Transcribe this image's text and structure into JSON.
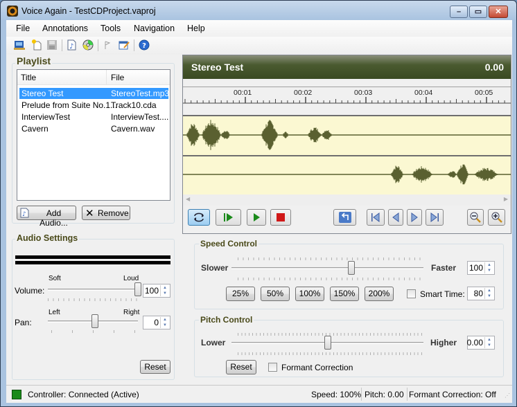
{
  "window": {
    "title": "Voice Again - TestCDProject.vaproj",
    "controls": {
      "minimize": "–",
      "maximize": "▭",
      "close": "✕"
    }
  },
  "menu": [
    "File",
    "Annotations",
    "Tools",
    "Navigation",
    "Help"
  ],
  "toolbar": {
    "icons": [
      "new-project-icon",
      "new-file-icon",
      "save-icon",
      "add-audio-icon",
      "cd-icon",
      "annotation-flag-icon",
      "edit-annotation-icon",
      "help-icon"
    ]
  },
  "playlist": {
    "title": "Playlist",
    "columns": [
      "Title",
      "File"
    ],
    "rows": [
      {
        "title": "Stereo Test",
        "file": "StereoTest.mp3",
        "selected": true
      },
      {
        "title": "Prelude from Suite No.1...",
        "file": "Track10.cda",
        "selected": false
      },
      {
        "title": "InterviewTest",
        "file": "InterviewTest....",
        "selected": false
      },
      {
        "title": "Cavern",
        "file": "Cavern.wav",
        "selected": false
      }
    ],
    "add_button": "Add Audio...",
    "remove_button": "Remove"
  },
  "audio_settings": {
    "title": "Audio Settings",
    "volume": {
      "label": "Volume:",
      "min_label": "Soft",
      "max_label": "Loud",
      "value": "100",
      "fraction": 1.0
    },
    "pan": {
      "label": "Pan:",
      "min_label": "Left",
      "max_label": "Right",
      "value": "0",
      "fraction": 0.5
    },
    "reset_button": "Reset"
  },
  "player": {
    "track_title": "Stereo Test",
    "time": "0.00",
    "ruler_labels": [
      "00:01",
      "00:02",
      "00:03",
      "00:04",
      "00:05"
    ],
    "wave_color": "#5a6030",
    "wave_bg": "#fbf8d2",
    "transport": [
      "loop-button",
      "play-from-start-button",
      "play-button",
      "stop-button",
      "return-button",
      "first-button",
      "previous-button",
      "next-button",
      "last-button",
      "zoom-out-button",
      "zoom-in-button"
    ]
  },
  "speed_control": {
    "title": "Speed Control",
    "min_label": "Slower",
    "max_label": "Faster",
    "value": "100",
    "fraction": 0.63,
    "presets": [
      "25%",
      "50%",
      "100%",
      "150%",
      "200%"
    ],
    "smart_time_label": "Smart Time:",
    "smart_time_checked": false,
    "smart_time_value": "80"
  },
  "pitch_control": {
    "title": "Pitch Control",
    "min_label": "Lower",
    "max_label": "Higher",
    "value": "0.00",
    "fraction": 0.5,
    "reset_button": "Reset",
    "formant_label": "Formant Correction",
    "formant_checked": false
  },
  "status": {
    "controller": "Controller: Connected (Active)",
    "speed": "Speed: 100%",
    "pitch": "Pitch: 0.00",
    "formant": "Formant Correction: Off",
    "indicator_color": "#1a8a1a"
  }
}
